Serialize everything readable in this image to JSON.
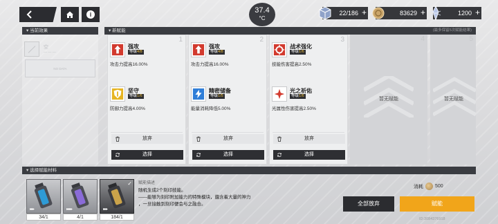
{
  "header": {
    "temperature": "37.4",
    "temperature_unit": "°C",
    "resources": [
      {
        "icon": "cube-resource-icon",
        "value": "22/186"
      },
      {
        "icon": "gold-coin-icon",
        "value": "83629"
      },
      {
        "icon": "crystal-energy-icon",
        "value": "1200"
      }
    ]
  },
  "current_effects": {
    "title": "当前效果",
    "slot_name": "空",
    "slot_sub": "— — —",
    "box_text": "NO DATA"
  },
  "new_talents": {
    "title": "新赋能",
    "note": "(最多保留5次赋能结果)",
    "columns": [
      {
        "index": "1",
        "talents": [
          {
            "icon": "attack-up-icon",
            "name": "强攻",
            "level_prefix": "等级",
            "level": "4/8",
            "desc": "攻击力提高16.00%"
          },
          {
            "icon": "shield-defense-icon",
            "name": "坚守",
            "level_prefix": "等级",
            "level": "1/6",
            "desc": "防御力提高4.00%"
          }
        ],
        "abandon": "放弃",
        "choose": "选择"
      },
      {
        "index": "2",
        "talents": [
          {
            "icon": "attack-up-icon",
            "name": "强攻",
            "level_prefix": "等级",
            "level": "4/8",
            "desc": "攻击力提高16.00%"
          },
          {
            "icon": "energy-storage-icon",
            "name": "精密储备",
            "level_prefix": "等级",
            "level": "1/5",
            "desc": "能量消耗降低5.00%"
          }
        ],
        "abandon": "放弃",
        "choose": "选择"
      },
      {
        "index": "3",
        "talents": [
          {
            "icon": "tactic-boost-icon",
            "name": "战术强化",
            "level_prefix": "等级",
            "level": "1/6",
            "desc": "技能伤害提高2.50%"
          },
          {
            "icon": "light-prayer-icon",
            "name": "光之祈佑",
            "level_prefix": "等级",
            "level": "1/6",
            "desc": "光属性伤害提高2.50%"
          }
        ],
        "abandon": "放弃",
        "choose": "选择"
      }
    ],
    "empty_columns": [
      {
        "index": "4",
        "label": "暂无赋能"
      },
      {
        "index": "5",
        "label": "暂无赋能"
      }
    ]
  },
  "materials": {
    "title": "选择赋能材料",
    "items": [
      {
        "count": "34/1",
        "arrows": "▸▸▸",
        "vial_color": "#2e9bd6"
      },
      {
        "count": "4/1",
        "arrows": "▸▸▸▸",
        "vial_color": "#8a6bd8"
      },
      {
        "count": "184/1",
        "arrows": "▸▸▸",
        "vial_color": "#caa34a",
        "selected": true
      }
    ],
    "desc_label": "赋能描述",
    "desc_lines": [
      "随机生成2个刻印技能。",
      "——能够为刻印附加能力的特殊模块，蕴含着大量的神力",
      "，一旦接触到刻印便会与之融合。"
    ],
    "consume_label": "消耗",
    "consume_value": "500",
    "all_abandon": "全部放弃",
    "talent_button": "赋能",
    "uid": "ID:3084376918"
  },
  "colors": {
    "accent_orange": "#f1a51a",
    "dark": "#2b2c30",
    "red_icon": "#d23a2e",
    "yellow_icon": "#e6b422",
    "blue_icon": "#2f7ed8"
  }
}
